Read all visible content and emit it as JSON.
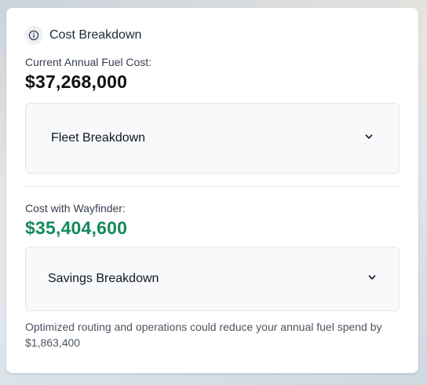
{
  "header": {
    "title": "Cost Breakdown",
    "icon": "info-icon"
  },
  "current": {
    "label": "Current Annual Fuel Cost:",
    "amount": "$37,268,000"
  },
  "fleet": {
    "label": "Fleet Breakdown",
    "icon": "chevron-down-icon"
  },
  "wayfinder": {
    "label": "Cost with Wayfinder:",
    "amount": "$35,404,600",
    "color": "#15895b"
  },
  "savings": {
    "label": "Savings Breakdown",
    "icon": "chevron-down-icon"
  },
  "note": "Optimized routing and operations could reduce your annual fuel spend by $1,863,400"
}
